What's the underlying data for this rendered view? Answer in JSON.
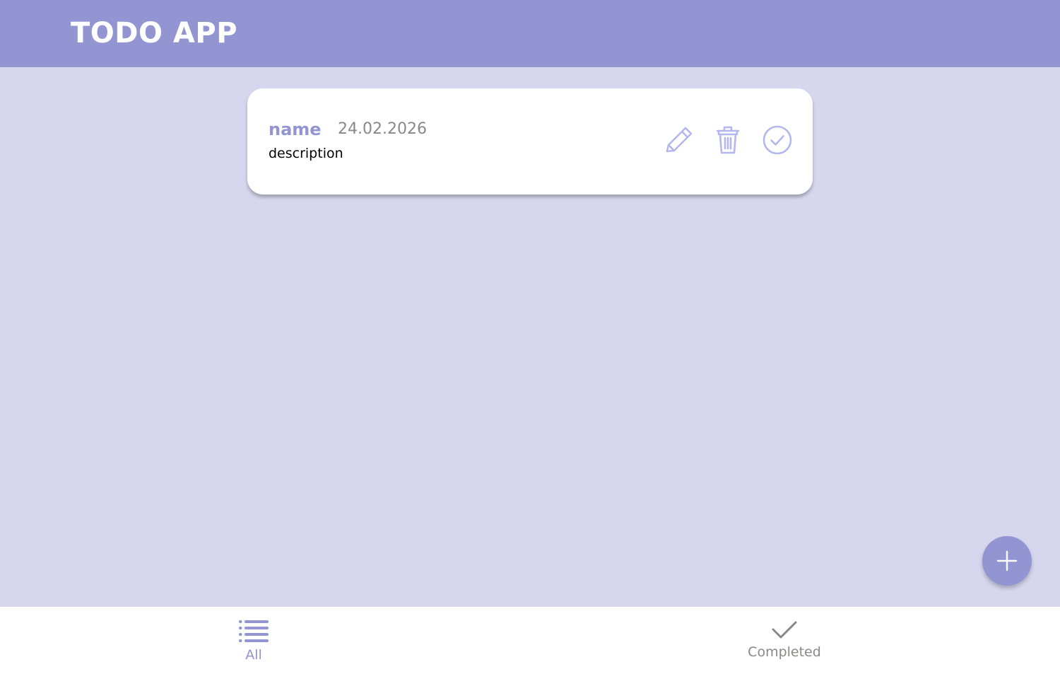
{
  "header": {
    "title": "TODO APP"
  },
  "todos": [
    {
      "name": "name",
      "date": "24.02.2026",
      "description": "description",
      "actions": {
        "edit_icon": "pencil-icon",
        "delete_icon": "trash-icon",
        "complete_icon": "check-circle-icon"
      }
    }
  ],
  "fab": {
    "icon": "plus-icon"
  },
  "bottom_nav": {
    "items": [
      {
        "label": "All",
        "icon": "list-icon",
        "active": true
      },
      {
        "label": "Completed",
        "icon": "check-icon",
        "active": false
      }
    ]
  },
  "colors": {
    "accent": "#9395d3",
    "background": "#d6d6ee",
    "card": "#ffffff",
    "icon_light": "#b3b7ee",
    "muted_text": "#8b8787"
  }
}
